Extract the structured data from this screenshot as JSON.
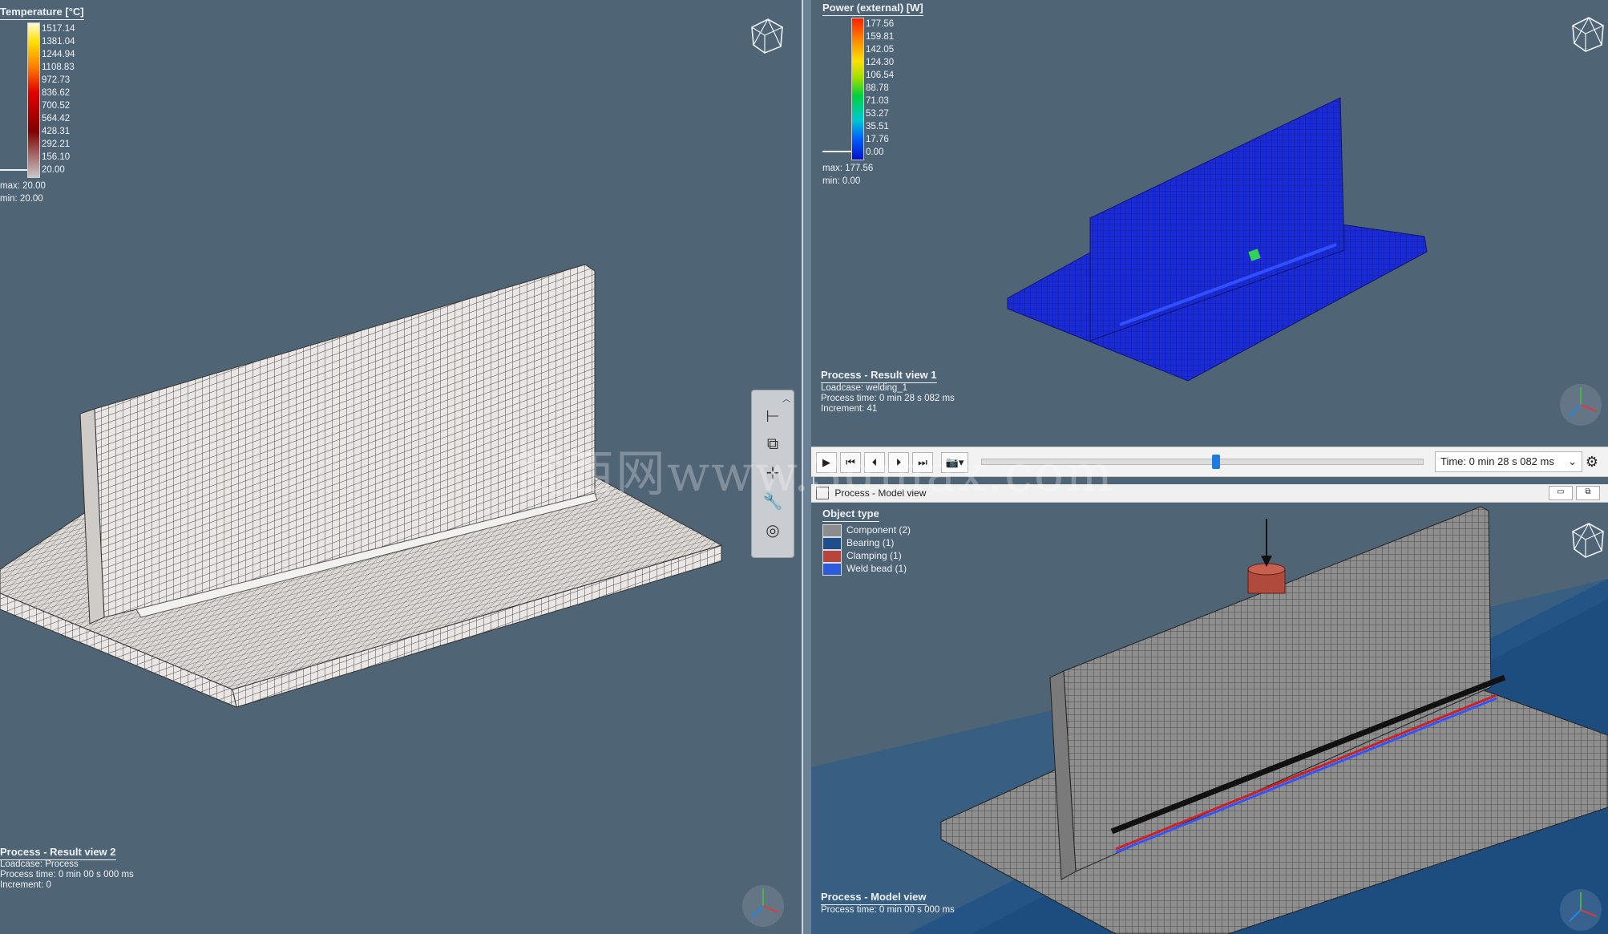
{
  "left_view": {
    "legend_title": "Temperature [°C]",
    "ticks": [
      "1517.14",
      "1381.04",
      "1244.94",
      "1108.83",
      "972.73",
      "836.62",
      "700.52",
      "564.42",
      "428.31",
      "292.21",
      "156.10",
      "20.00"
    ],
    "max": "max: 20.00",
    "min": "min: 20.00",
    "view_title": "Process - Result view 2",
    "loadcase": "Loadcase: Process",
    "process_time": "Process time: 0 min 00 s 000 ms",
    "increment": "Increment: 0"
  },
  "right_top_view": {
    "legend_title": "Power (external) [W]",
    "ticks": [
      "177.56",
      "159.81",
      "142.05",
      "124.30",
      "106.54",
      "88.78",
      "71.03",
      "53.27",
      "35.51",
      "17.76",
      "0.00"
    ],
    "max": "max: 177.56",
    "min": "min:    0.00",
    "view_title": "Process - Result view 1",
    "loadcase": "Loadcase: welding_1",
    "process_time": "Process time: 0 min 28 s 082 ms",
    "increment": "Increment: 41"
  },
  "playbar": {
    "time_label": "Time: 0 min 28 s 082 ms",
    "progress": 0.53
  },
  "model_view": {
    "window_title": "Process - Model view",
    "legend_title": "Object type",
    "legend_items": [
      {
        "label": "Component (2)",
        "color": "#8c8c8c"
      },
      {
        "label": "Bearing (1)",
        "color": "#1f4e8c"
      },
      {
        "label": "Clamping (1)",
        "color": "#b8453a"
      },
      {
        "label": "Weld bead (1)",
        "color": "#2c5be0"
      }
    ],
    "view_title": "Process - Model view",
    "process_time": "Process time: 0 min 00 s 000 ms"
  },
  "watermark": "赏西网www.3dmax.com",
  "icons": [
    "view-cube-icon",
    "axis-triad-icon",
    "play-icon",
    "skip-start-icon",
    "step-back-icon",
    "step-forward-icon",
    "skip-end-icon",
    "camera-icon",
    "gear-icon",
    "window-minimize-icon",
    "window-maximize-icon"
  ]
}
